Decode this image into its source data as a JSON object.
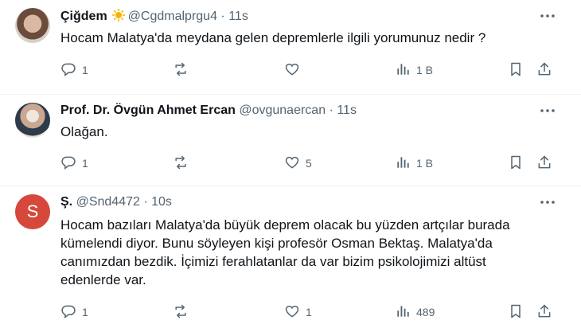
{
  "tweets": [
    {
      "name": "Çiğdem",
      "handle": "@Cgdmalprgu4",
      "separator": "·",
      "time": "11s",
      "text": "Hocam Malatya'da meydana gelen depremlerle ilgili yorumunuz nedir ?",
      "replies": "1",
      "retweets": "",
      "likes": "",
      "views": "1 B",
      "avatar_letter": ""
    },
    {
      "name": "Prof. Dr. Övgün Ahmet Ercan",
      "handle": "@ovgunaercan",
      "separator": "·",
      "time": "11s",
      "text": "Olağan.",
      "replies": "1",
      "retweets": "",
      "likes": "5",
      "views": "1 B",
      "avatar_letter": ""
    },
    {
      "name": "Ş.",
      "handle": "@Snd4472",
      "separator": "·",
      "time": "10s",
      "text": "Hocam bazıları Malatya'da büyük deprem olacak bu yüzden artçılar burada\nkümelendi diyor. Bunu söyleyen kişi profesör Osman Bektaş. Malatya'da\ncanımızdan bezdik. İçimizi ferahlatanlar da var bizim psikolojimizi altüst\nedenlerde var.",
      "replies": "1",
      "retweets": "",
      "likes": "1",
      "views": "489",
      "avatar_letter": "S"
    }
  ],
  "colors": {
    "text_primary": "#0f1419",
    "text_secondary": "#536471",
    "divider": "#eff3f4",
    "badge": "#f4b400",
    "avatar_s": "#d5483b"
  },
  "icons": [
    "more-icon",
    "reply-icon",
    "retweet-icon",
    "like-icon",
    "views-icon",
    "bookmark-icon",
    "share-icon",
    "badge-icon"
  ]
}
